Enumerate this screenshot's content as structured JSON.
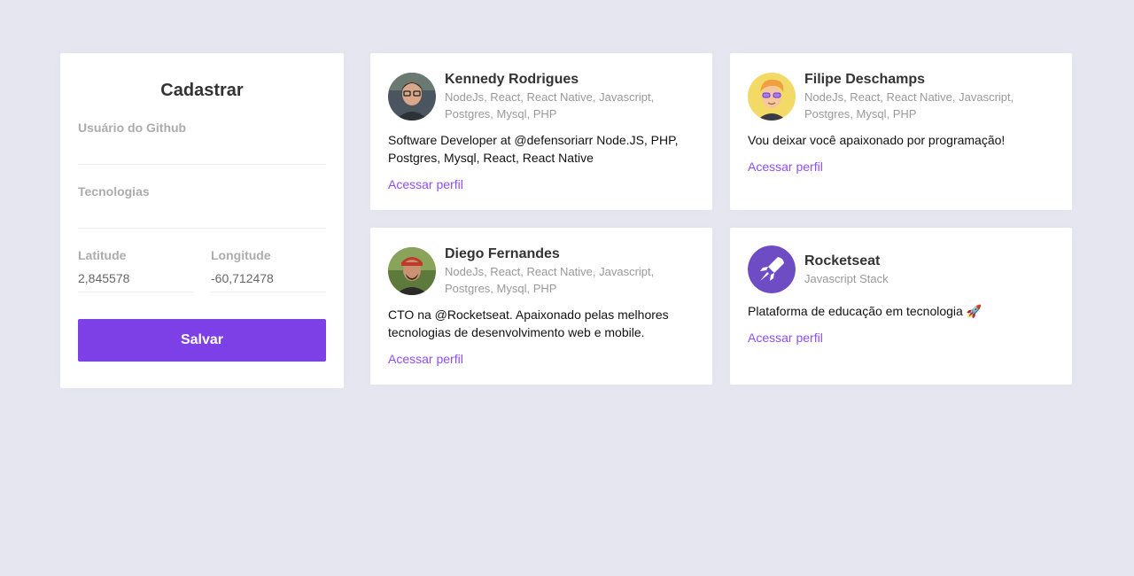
{
  "form": {
    "title": "Cadastrar",
    "github_label": "Usuário do Github",
    "github_value": "",
    "techs_label": "Tecnologias",
    "techs_value": "",
    "latitude_label": "Latitude",
    "latitude_value": "2,845578",
    "longitude_label": "Longitude",
    "longitude_value": "-60,712478",
    "save_label": "Salvar"
  },
  "colors": {
    "accent": "#7d40e7",
    "link": "#8e4dff",
    "background": "#e6e6f0"
  },
  "devs": [
    {
      "name": "Kennedy Rodrigues",
      "techs": "NodeJs, React, React Native, Javascript, Postgres, Mysql, PHP",
      "bio": "Software Developer at @defensoriarr Node.JS, PHP, Postgres, Mysql, React, React Native",
      "link": "Acessar perfil",
      "avatar_icon": "user-photo-icon"
    },
    {
      "name": "Filipe Deschamps",
      "techs": "NodeJs, React, React Native, Javascript, Postgres, Mysql, PHP",
      "bio": "Vou deixar você apaixonado por programação!",
      "link": "Acessar perfil",
      "avatar_icon": "cartoon-avatar-icon"
    },
    {
      "name": "Diego Fernandes",
      "techs": "NodeJs, React, React Native, Javascript, Postgres, Mysql, PHP",
      "bio": "CTO na @Rocketseat. Apaixonado pelas melhores tecnologias de desenvolvimento web e mobile.",
      "link": "Acessar perfil",
      "avatar_icon": "user-photo-icon"
    },
    {
      "name": "Rocketseat",
      "techs": "Javascript Stack",
      "bio": "Plataforma de educação em tecnologia 🚀",
      "link": "Acessar perfil",
      "avatar_icon": "rocket-logo-icon"
    }
  ]
}
